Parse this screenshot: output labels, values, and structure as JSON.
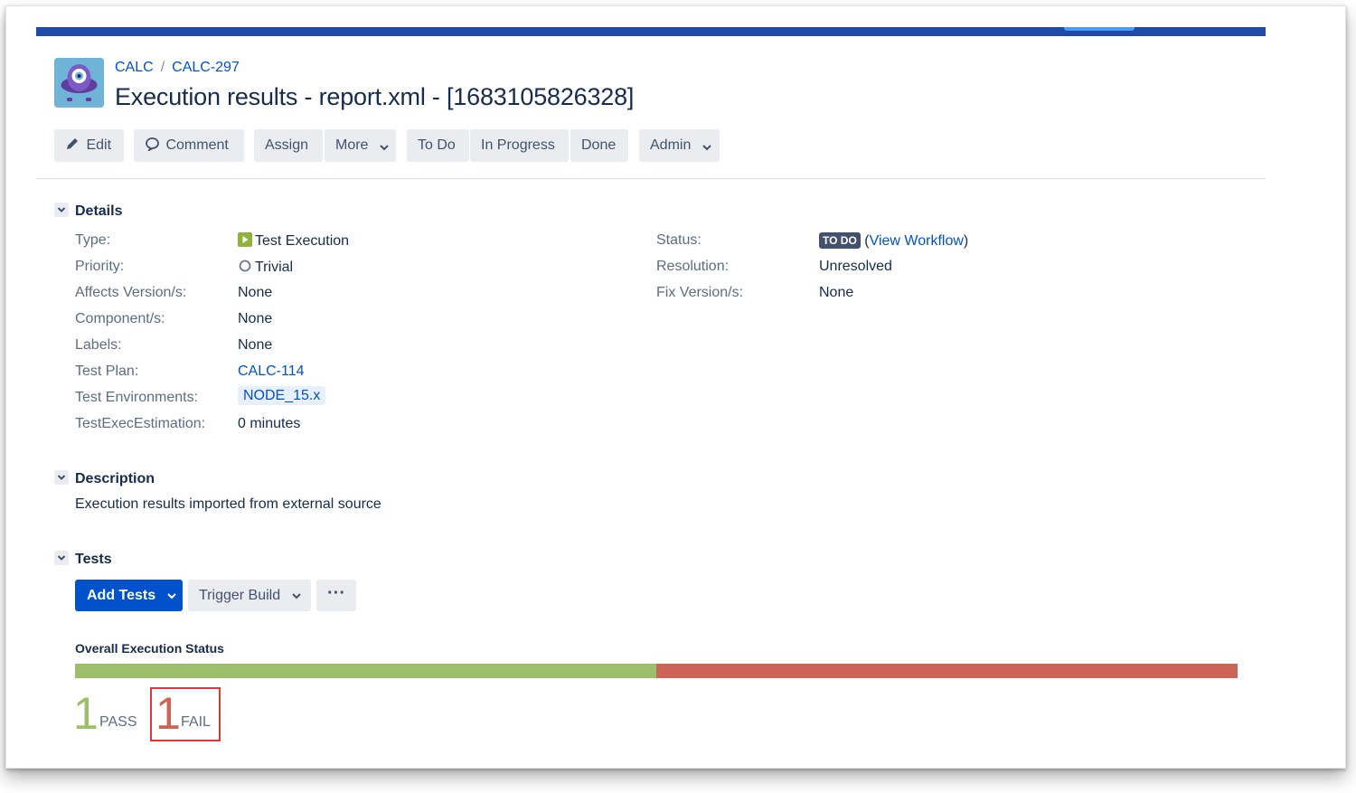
{
  "breadcrumb": {
    "project": "CALC",
    "issue_key": "CALC-297"
  },
  "title": "Execution results - report.xml - [1683105826328]",
  "toolbar": {
    "edit": "Edit",
    "comment": "Comment",
    "assign": "Assign",
    "more": "More",
    "todo": "To Do",
    "in_progress": "In Progress",
    "done": "Done",
    "admin": "Admin"
  },
  "details": {
    "heading": "Details",
    "left": [
      {
        "label": "Type:",
        "value": "Test Execution",
        "icon": "test-execution-icon"
      },
      {
        "label": "Priority:",
        "value": "Trivial",
        "icon": "trivial-priority-icon"
      },
      {
        "label": "Affects Version/s:",
        "value": "None"
      },
      {
        "label": "Component/s:",
        "value": "None"
      },
      {
        "label": "Labels:",
        "value": "None"
      },
      {
        "label": "Test Plan:",
        "value": "CALC-114"
      },
      {
        "label": "Test Environments:",
        "value": "NODE_15.x"
      },
      {
        "label": "TestExecEstimation:",
        "value": "0 minutes"
      }
    ],
    "right": [
      {
        "label": "Status:",
        "status": "TO DO",
        "link_open": "(",
        "link": "View Workflow",
        "link_close": ")"
      },
      {
        "label": "Resolution:",
        "value": "Unresolved"
      },
      {
        "label": "Fix Version/s:",
        "value": "None"
      }
    ]
  },
  "description": {
    "heading": "Description",
    "text": "Execution results imported from external source"
  },
  "tests": {
    "heading": "Tests",
    "add_tests": "Add Tests",
    "trigger_build": "Trigger Build",
    "more": "···"
  },
  "execution_status": {
    "title": "Overall Execution Status",
    "segments": [
      {
        "status": "PASS",
        "count": "1",
        "fraction": 0.5,
        "color": "#9dbf6b"
      },
      {
        "status": "FAIL",
        "count": "1",
        "fraction": 0.5,
        "color": "#cc6558"
      }
    ]
  },
  "colors": {
    "primary": "#0052cc",
    "topbar": "#1f4aa6",
    "pass": "#9dbf6b",
    "fail": "#cc6558",
    "highlight_box": "#de3b2f"
  }
}
